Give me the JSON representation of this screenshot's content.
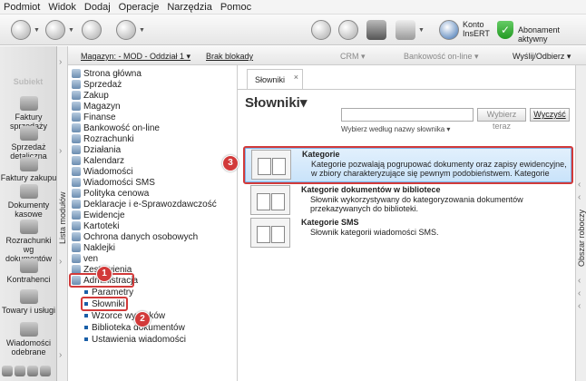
{
  "menubar": {
    "items": [
      "Podmiot",
      "Widok",
      "Dodaj",
      "Operacje",
      "Narzędzia",
      "Pomoc"
    ]
  },
  "toolbar": {
    "konto_line1": "Konto",
    "konto_line2": "InsERT",
    "abonament": "Abonament aktywny"
  },
  "infobar": {
    "magazyn": "Magazyn: - MOD - Oddział 1 ▾",
    "blokady": "Brak blokady",
    "crm": "CRM ▾",
    "bankowosc": "Bankowość on-line ▾",
    "wyslij": "Wyślij/Odbierz ▾"
  },
  "left_panel": {
    "logo_text": "Subiekt",
    "items": [
      "Faktury sprzedaży",
      "Sprzedaż detaliczna",
      "Faktury zakupu",
      "Dokumenty kasowe",
      "Rozrachunki wg dokumentów",
      "Kontrahenci",
      "Towary i usługi",
      "Wiadomości odebrane"
    ],
    "strip_label": "Lista modułów"
  },
  "tree": {
    "items": [
      "Strona główna",
      "Sprzedaż",
      "Zakup",
      "Magazyn",
      "Finanse",
      "Bankowość on-line",
      "Rozrachunki",
      "Działania",
      "Kalendarz",
      "Wiadomości",
      "Wiadomości SMS",
      "Polityka cenowa",
      "Deklaracje i e-Sprawozdawczość",
      "Ewidencje",
      "Kartoteki",
      "Ochrona danych osobowych",
      "Naklejki",
      "ven",
      "Zestawienia",
      "Administracja"
    ],
    "sub_items": [
      "Parametry",
      "Słowniki",
      "Wzorce wydruków",
      "Biblioteka dokumentów",
      "Ustawienia wiadomości"
    ]
  },
  "badges": [
    "1",
    "2",
    "3"
  ],
  "main": {
    "tab_label": "Słowniki",
    "tab_close": "×",
    "page_title": "Słowniki▾",
    "search_placeholder": "",
    "search_button": "Wybierz teraz",
    "clear_button": "Wyczyść",
    "sort_link": "Wybierz według nazwy słownika ▾",
    "items": [
      {
        "title": "Kategorie",
        "desc": "Kategorie pozwalają pogrupować dokumenty oraz zapisy ewidencyjne, w zbiory charakteryzujące się pewnym podobieństwem. Kategorie"
      },
      {
        "title": "Kategorie dokumentów w bibliotece",
        "desc": "Słownik wykorzystywany do kategoryzowania dokumentów przekazywanych do biblioteki."
      },
      {
        "title": "Kategorie SMS",
        "desc": "Słownik kategorii wiadomości SMS."
      }
    ]
  },
  "right_strip": {
    "label": "Obszar roboczy"
  },
  "colors": {
    "highlight": "#d23a3a",
    "selection": "#c9e3fa",
    "accent": "#1a5fa8"
  }
}
